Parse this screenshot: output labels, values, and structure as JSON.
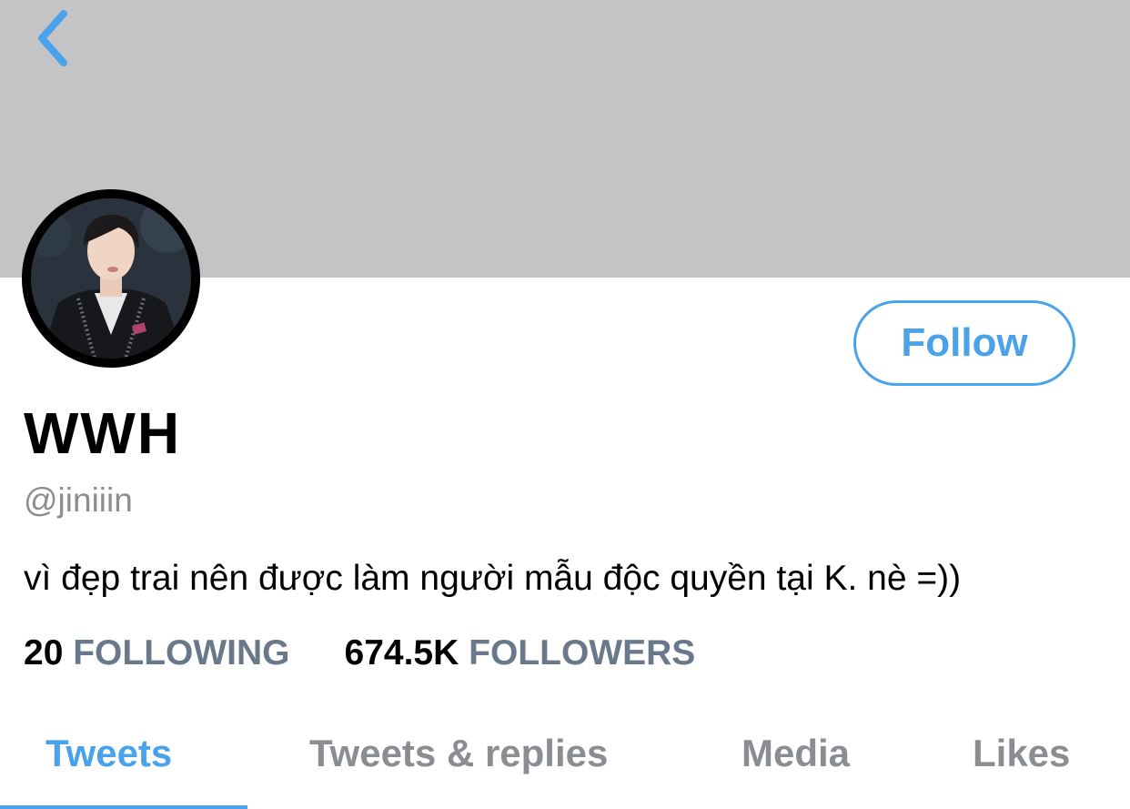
{
  "profile": {
    "display_name": "WWH",
    "handle": "@jiniiin",
    "bio": "vì đẹp trai nên được làm người mẫu độc quyền tại K. nè =))",
    "follow_label": "Follow"
  },
  "stats": {
    "following_count": "20",
    "following_label": "FOLLOWING",
    "followers_count": "674.5K",
    "followers_label": "FOLLOWERS"
  },
  "tabs": [
    {
      "label": "Tweets",
      "active": true
    },
    {
      "label": "Tweets & replies",
      "active": false
    },
    {
      "label": "Media",
      "active": false
    },
    {
      "label": "Likes",
      "active": false
    }
  ],
  "icons": {
    "back": "chevron-left-icon"
  },
  "colors": {
    "accent": "#4aa2ea",
    "banner": "#c4c4c6",
    "secondary_text": "#8a8d91",
    "stat_label": "#69788a"
  }
}
